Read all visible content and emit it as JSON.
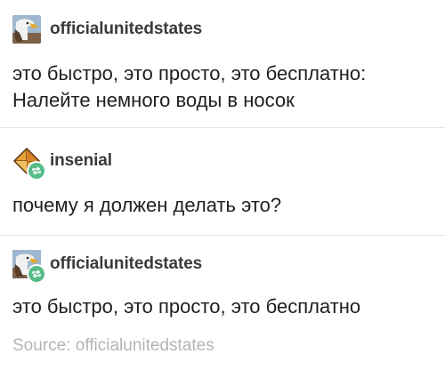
{
  "posts": [
    {
      "username": "officialunitedstates",
      "avatar_icon": "eagle-icon",
      "lines": [
        "это быстро, это просто, это бесплатно:",
        "Налейте немного воды в носок"
      ]
    },
    {
      "username": "insenial",
      "avatar_icon": "diamond-icon",
      "reblog_icon": "reblog-icon",
      "lines": [
        "почему я должен делать это?"
      ]
    },
    {
      "username": "officialunitedstates",
      "avatar_icon": "eagle-icon",
      "reblog_icon": "reblog-icon",
      "lines": [
        "это быстро, это просто, это бесплатно"
      ]
    }
  ],
  "source": {
    "label": "Source: officialunitedstates"
  },
  "colors": {
    "reblog_badge": "#56bc8a",
    "username": "#3a3a3a",
    "body_text": "#1f1f1f",
    "source_text": "#b4b4b4",
    "divider": "#e4e4e4"
  }
}
